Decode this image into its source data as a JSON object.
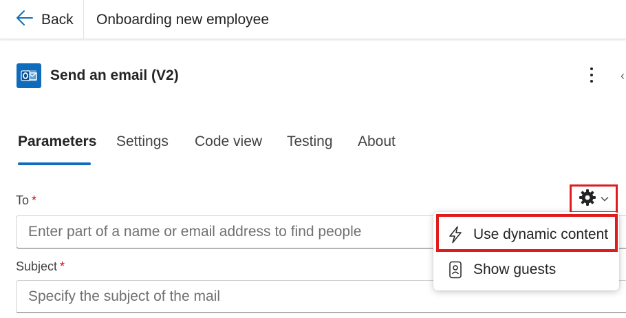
{
  "header": {
    "back_label": "Back",
    "flow_title": "Onboarding new employee"
  },
  "action": {
    "title": "Send an email (V2)",
    "icon": "outlook-icon",
    "brand_color": "#0f6cbd"
  },
  "tabs": [
    {
      "label": "Parameters",
      "active": true
    },
    {
      "label": "Settings",
      "active": false
    },
    {
      "label": "Code view",
      "active": false
    },
    {
      "label": "Testing",
      "active": false
    },
    {
      "label": "About",
      "active": false
    }
  ],
  "fields": {
    "to": {
      "label": "To",
      "required_mark": "*",
      "placeholder": "Enter part of a name or email address to find people"
    },
    "subject": {
      "label": "Subject",
      "required_mark": "*",
      "placeholder": "Specify the subject of the mail"
    }
  },
  "menu": {
    "items": [
      {
        "label": "Use dynamic content",
        "icon": "lightning-icon"
      },
      {
        "label": "Show guests",
        "icon": "contact-card-icon"
      }
    ]
  },
  "colors": {
    "accent": "#0f6cbd",
    "highlight": "#e01b1b",
    "required": "#c50f1f"
  }
}
